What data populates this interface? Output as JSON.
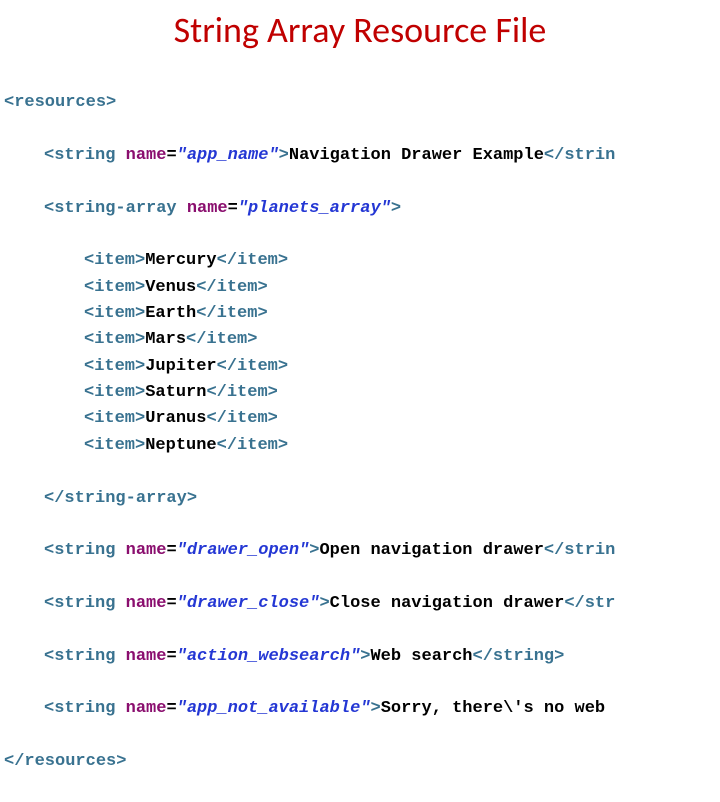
{
  "title": "String Array Resource File",
  "colors": {
    "heading": "#c00000",
    "tag": "#397290",
    "attr": "#8a0e6e",
    "value": "#2437d4",
    "text": "#000000"
  },
  "xml": {
    "root_open": "<resources>",
    "root_close": "</resources>",
    "string_tag": "string",
    "string_array_tag": "string-array",
    "item_tag": "item",
    "attr_name": "name",
    "app_name": {
      "attr_value": "\"app_name\"",
      "text": "Navigation Drawer Example",
      "close_frag": "</strin"
    },
    "planets": {
      "attr_value": "\"planets_array\"",
      "open_close": ">",
      "items": [
        "Mercury",
        "Venus",
        "Earth",
        "Mars",
        "Jupiter",
        "Saturn",
        "Uranus",
        "Neptune"
      ],
      "close": "</string-array>"
    },
    "drawer_open": {
      "attr_value": "\"drawer_open\"",
      "text": "Open navigation drawer",
      "close_frag": "</strin"
    },
    "drawer_close": {
      "attr_value": "\"drawer_close\"",
      "text": "Close navigation drawer",
      "close_frag": "</str"
    },
    "action_websearch": {
      "attr_value": "\"action_websearch\"",
      "text": "Web search",
      "close_frag": "</string>"
    },
    "app_not_available": {
      "attr_value": "\"app_not_available\"",
      "text": "Sorry, there\\'s no web"
    }
  }
}
